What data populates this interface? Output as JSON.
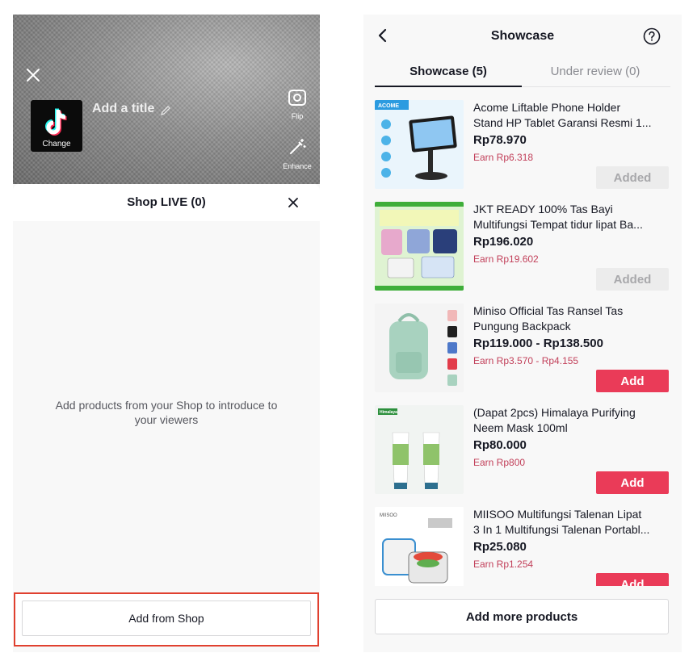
{
  "left": {
    "camera": {
      "cover_label": "Change",
      "title_placeholder": "Add a title",
      "flip_label": "Flip",
      "enhance_label": "Enhance"
    },
    "sheet": {
      "title": "Shop LIVE (0)",
      "empty_message": "Add products from your Shop to introduce to your viewers",
      "add_button": "Add from Shop"
    }
  },
  "right": {
    "header": {
      "title": "Showcase"
    },
    "tabs": [
      {
        "label": "Showcase (5)",
        "active": true
      },
      {
        "label": "Under review (0)",
        "active": false
      }
    ],
    "products": [
      {
        "name_line1": "Acome Liftable Phone Holder",
        "name_line2": "Stand HP Tablet Garansi Resmi 1...",
        "price": "Rp78.970",
        "earn": "Earn Rp6.318",
        "button": "Added",
        "state": "added",
        "thumb_text": "ACOME"
      },
      {
        "name_line1": "JKT READY 100% Tas Bayi",
        "name_line2": "Multifungsi Tempat tidur lipat Ba...",
        "price": "Rp196.020",
        "earn": "Earn Rp19.602",
        "button": "Added",
        "state": "added"
      },
      {
        "name_line1": "Miniso Official Tas Ransel Tas",
        "name_line2": "Pungung Backpack",
        "price": "Rp119.000 - Rp138.500",
        "earn": "Earn Rp3.570 - Rp4.155",
        "button": "Add",
        "state": "add"
      },
      {
        "name_line1": "(Dapat 2pcs) Himalaya Purifying",
        "name_line2": "Neem Mask 100ml",
        "price": "Rp80.000",
        "earn": "Earn Rp800",
        "button": "Add",
        "state": "add",
        "thumb_text": "Himalaya"
      },
      {
        "name_line1": "MIISOO Multifungsi Talenan Lipat",
        "name_line2": "3 In 1 Multifungsi Talenan Portabl...",
        "price": "Rp25.080",
        "earn": "Earn Rp1.254",
        "button": "Add",
        "state": "add",
        "thumb_text": "MIISOO"
      }
    ],
    "footer": {
      "add_more": "Add more products"
    },
    "colors": {
      "accent": "#ea3b58",
      "earn": "#c2405a",
      "highlight": "#e0402f"
    }
  }
}
